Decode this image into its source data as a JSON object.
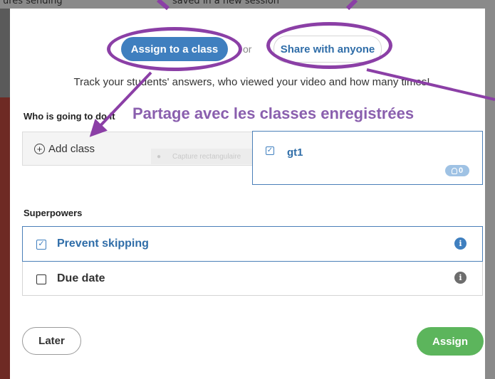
{
  "background": {
    "left_text": "ures sending",
    "center_text": "saved in a new session"
  },
  "share_modes": {
    "assign_to_class_label": "Assign to a class",
    "or_label": "or",
    "share_with_anyone_label": "Share with anyone"
  },
  "description": "Track your students' answers, who viewed your video and how many times!",
  "annotation": {
    "title": "Partage avec les classes enregistrées"
  },
  "who_section": {
    "label": "Who is going to do it",
    "add_class_label": "Add class",
    "ghost_tooltip": "Capture rectangulaire",
    "classes": [
      {
        "name": "gt1",
        "checked": true,
        "student_count": "0"
      }
    ]
  },
  "superpowers": {
    "label": "Superpowers",
    "items": [
      {
        "label": "Prevent skipping",
        "checked": true,
        "icon": "info-icon"
      },
      {
        "label": "Due date",
        "checked": false,
        "icon": "info-icon"
      }
    ]
  },
  "footer": {
    "later_label": "Later",
    "assign_label": "Assign"
  },
  "colors": {
    "primary": "#3f7fbf",
    "success": "#5cb55c",
    "annotation": "#8b3fa6"
  }
}
